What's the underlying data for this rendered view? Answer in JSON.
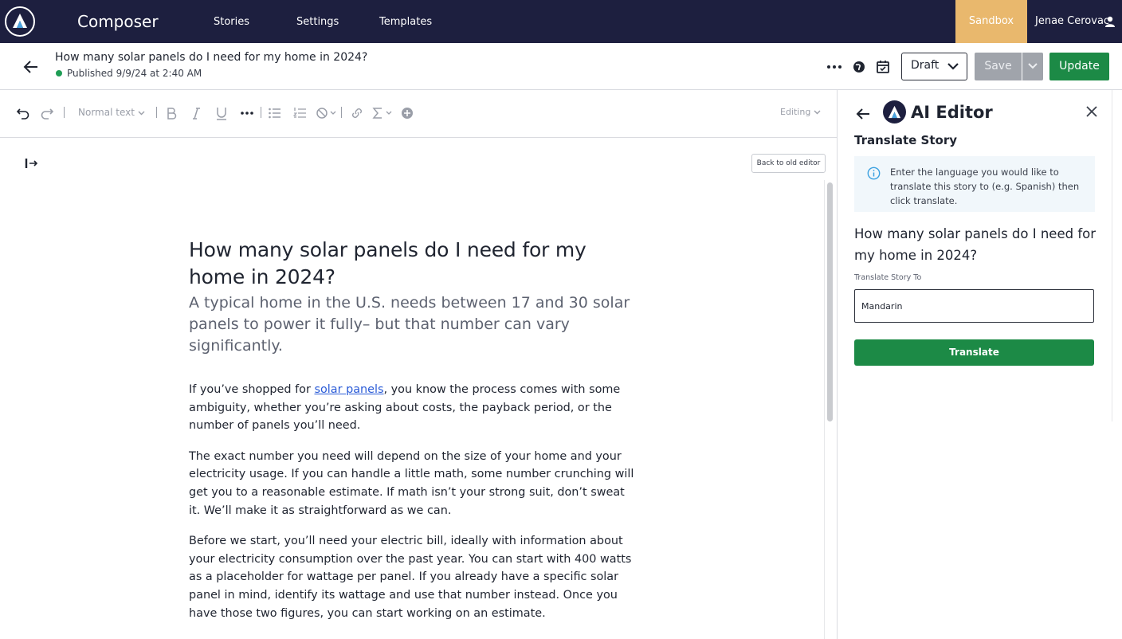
{
  "app": {
    "brand": "Composer",
    "nav": [
      "Stories",
      "Settings",
      "Templates"
    ],
    "environment": "Sandbox",
    "user_name": "Jenae Cerovac",
    "colors": {
      "nav_bg": "#1d1f3f",
      "sandbox": "#e9b86d",
      "accent_green": "#1c8a46"
    }
  },
  "story_bar": {
    "title": "How many solar panels do I need for my home in 2024?",
    "status": "Published 9/9/24 at 2:40 AM",
    "status_select": "Draft",
    "save_label": "Save",
    "update_label": "Update"
  },
  "toolbar": {
    "text_style": "Normal text",
    "mode": "Editing",
    "icons": [
      "undo-icon",
      "redo-icon",
      "bold-icon",
      "italic-icon",
      "underline-icon",
      "more-icon",
      "bullet-list-icon",
      "numbered-list-icon",
      "clear-format-icon",
      "link-icon",
      "sigma-icon",
      "add-icon"
    ]
  },
  "editor": {
    "old_editor_label": "Back to old editor",
    "article": {
      "title": "How many solar panels do I need for my home in 2024?",
      "subtitle": "A typical home in the U.S. needs between 17 and 30 solar panels to power it fully– but that number can vary significantly.",
      "p1_before": "If you’ve shopped for ",
      "p1_link": "solar panels",
      "p1_after": ", you know the process comes with some ambiguity, whether you’re asking about costs, the payback period, or the number of panels you’ll need.",
      "p2": "The exact number you need will depend on the size of your home and your electricity usage. If you can handle a little math, some number crunching will get you to a reasonable estimate. If math isn’t your strong suit, don’t sweat it. We’ll make it as straightforward as we can.",
      "p3": "Before we start, you’ll need your electric bill, ideally with information about your electricity consumption over the past year. You can start with 400 watts as a placeholder for wattage per panel. If you already have a specific solar panel in mind, identify its wattage and use that number instead. Once you have those two figures, you can start working on an estimate."
    }
  },
  "ai_panel": {
    "title": "AI Editor",
    "heading": "Translate Story",
    "info": "Enter the language you would like to translate this story to (e.g. Spanish) then click translate.",
    "story_title": "How many solar panels do I need for my home in 2024?",
    "field_label": "Translate Story To",
    "field_value": "Mandarin",
    "translate_label": "Translate"
  }
}
